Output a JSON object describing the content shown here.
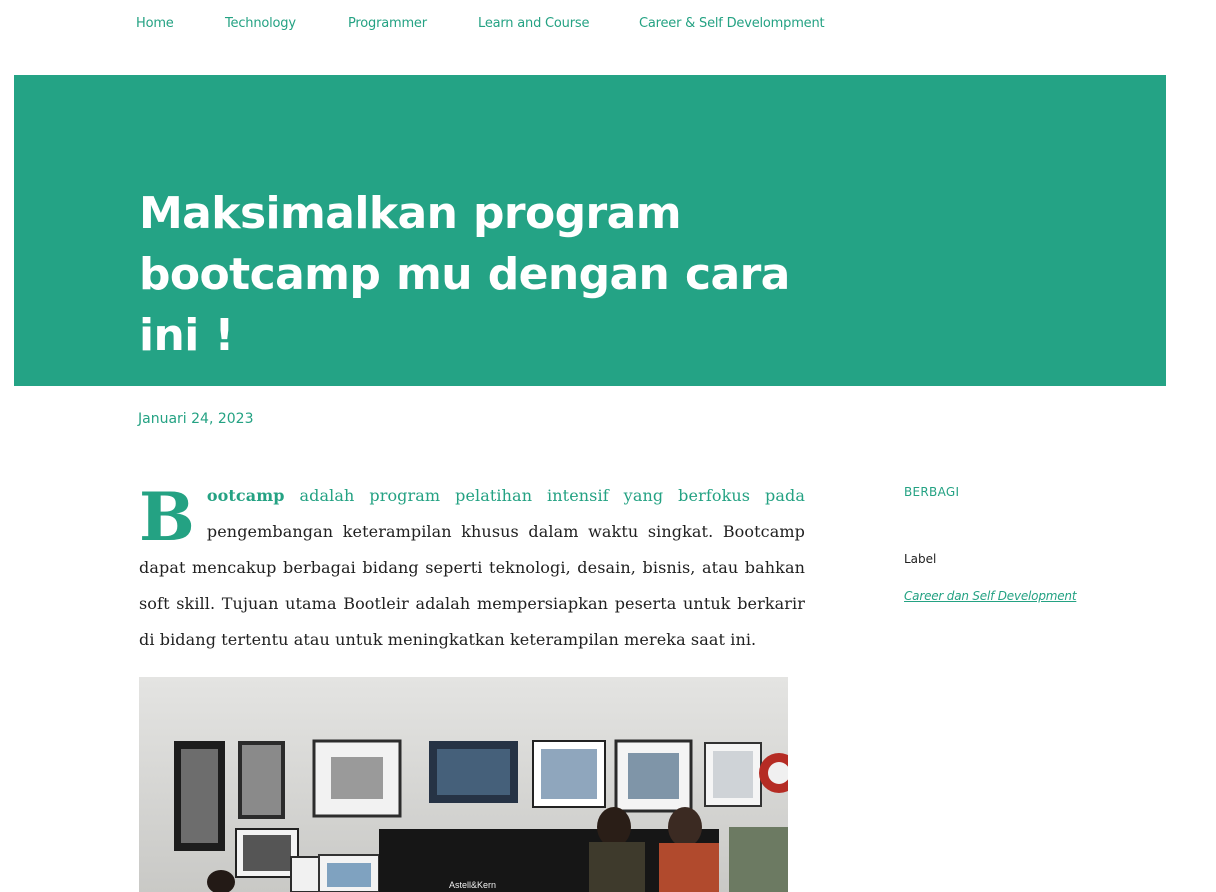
{
  "nav": {
    "items": [
      {
        "label": "Home"
      },
      {
        "label": "Technology"
      },
      {
        "label": "Programmer"
      },
      {
        "label": "Learn and Course"
      },
      {
        "label": "Career & Self Develompment"
      }
    ]
  },
  "post": {
    "title": "Maksimalkan program bootcamp mu dengan cara ini !",
    "date": "Januari 24, 2023",
    "dropcap": "B",
    "lead_bold": "ootcamp",
    "lead_green": " adalah program pelatihan intensif yang berfokus pada",
    "body": " pengembangan keterampilan khusus dalam waktu singkat. Bootcamp dapat mencakup berbagai bidang seperti teknologi, desain, bisnis, atau bahkan soft skill. Tujuan utama Bootleir adalah mempersiapkan peserta untuk berkarir di bidang tertentu atau untuk meningkatkan keterampilan mereka saat ini.",
    "image_caption_text": "Astell&Kern"
  },
  "sidebar": {
    "share_label": "BERBAGI",
    "label_heading": "Label",
    "label_link": "Career dan Self Development"
  },
  "colors": {
    "accent": "#24a283",
    "hero_bg": "#24a385",
    "text": "#212121"
  }
}
